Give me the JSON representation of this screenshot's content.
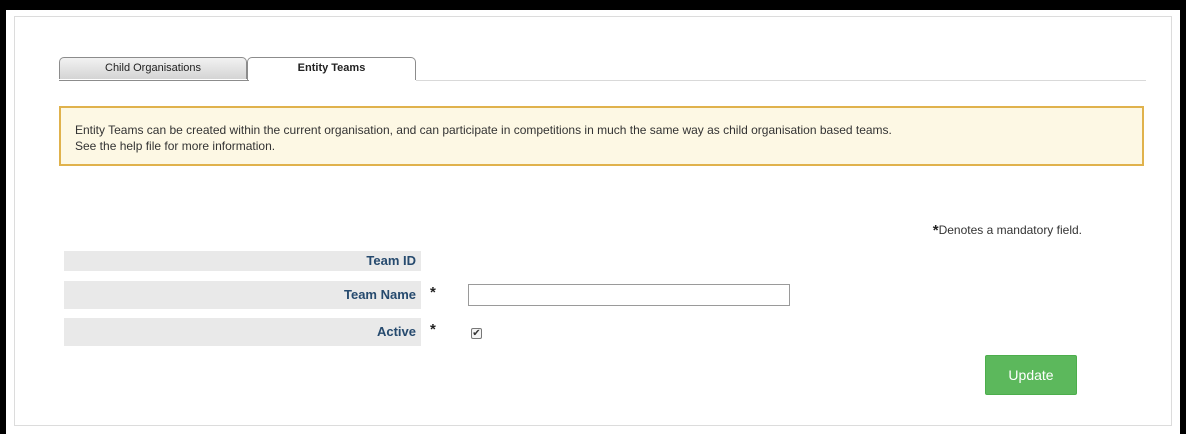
{
  "tabs": [
    {
      "label": "Child Organisations",
      "active": false
    },
    {
      "label": "Entity Teams",
      "active": true
    }
  ],
  "info": {
    "line1": "Entity Teams can be created within the current organisation, and can participate in competitions in much the same way as child organisation based teams.",
    "line2": "See the help file for more information."
  },
  "mandatory_note": {
    "star": "*",
    "text": "Denotes a mandatory field."
  },
  "form": {
    "team_id_label": "Team ID",
    "team_name_label": "Team Name",
    "team_name_required": "*",
    "team_name_value": "",
    "active_label": "Active",
    "active_required": "*",
    "active_checked": true,
    "checkbox_glyph": "✔"
  },
  "update_button_label": "Update",
  "colors": {
    "info_border": "#e0b24c",
    "info_bg": "#fdf8e4",
    "label_text": "#264a6e",
    "button": "#5cb85c"
  }
}
